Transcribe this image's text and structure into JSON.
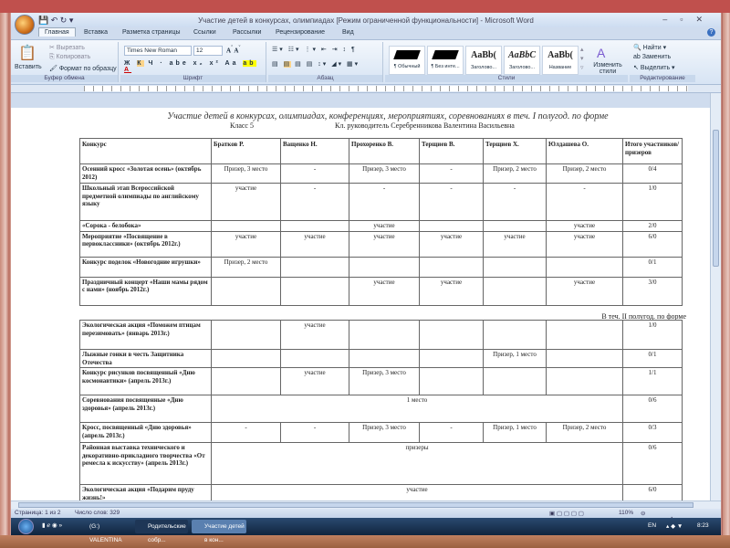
{
  "window": {
    "title": "Участие детей в конкурсах, олимпиадах [Режим ограниченной функциональности] - Microsoft Word"
  },
  "tabs": [
    "Главная",
    "Вставка",
    "Разметка страницы",
    "Ссылки",
    "Рассылки",
    "Рецензирование",
    "Вид"
  ],
  "ribbon": {
    "clipboard": {
      "label": "Буфер обмена",
      "paste": "Вставить",
      "cut": "Вырезать",
      "copy": "Копировать",
      "format": "Формат по образцу"
    },
    "font": {
      "label": "Шрифт",
      "name": "Times New Roman",
      "size": "12"
    },
    "paragraph": {
      "label": "Абзац"
    },
    "styles": {
      "label": "Стили",
      "items": [
        {
          "preview": "",
          "name": "¶ Обычный"
        },
        {
          "preview": "",
          "name": "¶ Без инте..."
        },
        {
          "preview": "AaBb(",
          "name": "Заголово..."
        },
        {
          "preview": "AaBbC",
          "name": "Заголово..."
        },
        {
          "preview": "AaBb(",
          "name": "Название"
        }
      ],
      "change": "Изменить стили"
    },
    "editing": {
      "label": "Редактирование",
      "find": "Найти",
      "replace": "Заменить",
      "select": "Выделить"
    }
  },
  "doc": {
    "title": "Участие детей в конкурсах, олимпиадах, конференциях, мероприятиях, соревнованиях в теч. I полугод. по форме",
    "class": "Класс 5",
    "teacher": "Кл. руководитель Серебренникова Валентина Васильевна",
    "note2": "В теч. II полугод. по форме",
    "headers": [
      "Конкурс",
      "Братков Р.",
      "Ващенко Н.",
      "Прохоренко В.",
      "Терщиев В.",
      "Терщиев Х.",
      "Юлдашева О.",
      "Итого участников/ призеров"
    ],
    "rows1": [
      [
        "Осенний кросс «Золотая осень» (октябрь 2012)",
        "Призер, 3 место",
        "-",
        "Призер, 3 место",
        "-",
        "Призер, 2 место",
        "Призер, 2 место",
        "0/4"
      ],
      [
        "Школьный этап Всероссийской предметной олимпиады по английскому языку",
        "участие",
        "-",
        "-",
        "-",
        "-",
        "-",
        "1/0"
      ],
      [
        "«Сорока - белобока»",
        "",
        "",
        "участие",
        "",
        "",
        "участие",
        "2/0"
      ],
      [
        "Мероприятие «Посвящение в первоклассники» (октябрь 2012г.)",
        "участие",
        "участие",
        "участие",
        "участие",
        "участие",
        "участие",
        "6/0"
      ],
      [
        "Конкурс поделок «Новогодние игрушки»",
        "Призер, 2 место",
        "",
        "",
        "",
        "",
        "",
        "0/1"
      ],
      [
        "Праздничный концерт «Наши мамы рядом с нами» (ноябрь 2012г.)",
        "",
        "",
        "участие",
        "участие",
        "",
        "участие",
        "3/0"
      ]
    ],
    "rows2": [
      [
        "Экологическая акция «Поможем птицам перезимовать» (январь 2013г.)",
        "",
        "участие",
        "",
        "",
        "",
        "",
        "1/0"
      ],
      [
        "Лыжные гонки в честь Защитника Отечества",
        "",
        "",
        "",
        "",
        "Призер, 1 место",
        "",
        "0/1"
      ],
      [
        "Конкурс рисунков посвященный «Дню космонавтики» (апрель 2013г.)",
        "",
        "участие",
        "Призер, 3 место",
        "",
        "",
        "",
        "1/1"
      ],
      [
        "Соревнования посвященные «Дню здоровья» (апрель 2013г.)",
        "1 место",
        "0/6"
      ],
      [
        "Кросс, посвященный «Дню здоровья» (апрель 2013г.)",
        "-",
        "-",
        "Призер, 3 место",
        "-",
        "Призер, 1 место",
        "Призер, 2 место",
        "0/3"
      ],
      [
        "Районная выставка технического и декоративно-прикладного творчества «От ремесла к искусству» (апрель 2013г.)",
        "призеры",
        "0/6"
      ],
      [
        "Экологическая акция «Подарим пруду жизнь!»",
        "участие",
        "6/0"
      ]
    ]
  },
  "status": {
    "page": "Страница: 1 из 2",
    "words": "Число слов: 329",
    "zoom": "110%"
  },
  "taskbar": {
    "items": [
      "(G:) VALENTINA",
      "Родительские собр...",
      "Участие детей в кон..."
    ],
    "lang": "EN",
    "time": "8:23"
  }
}
